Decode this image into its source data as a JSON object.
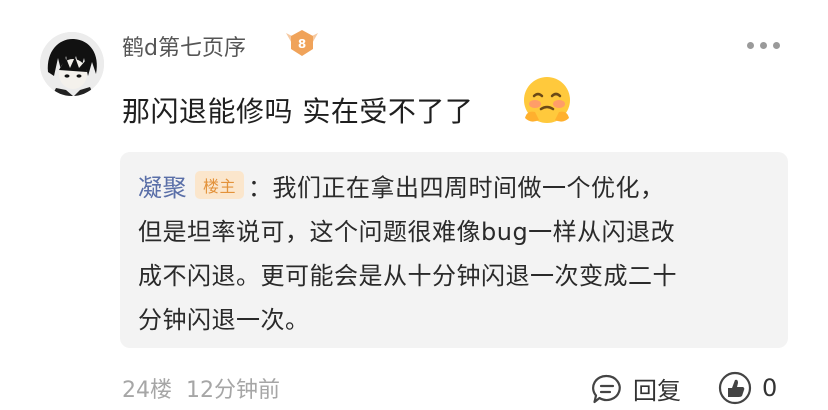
{
  "comment": {
    "username": "鹤d第七页序",
    "level": "8",
    "text": "那闪退能修吗 实在受不了了",
    "emoji_name": "hot-face-emoji"
  },
  "reply": {
    "author": "凝聚",
    "host_badge": "楼主",
    "separator": "：",
    "lines": [
      "我们正在拿出四周时间做一个优化，",
      "但是坦率说可，这个问题很难像bug一样从闪退改",
      "成不闪退。更可能会是从十分钟闪退一次变成二十",
      "分钟闪退一次。"
    ]
  },
  "footer": {
    "floor": "24楼",
    "time": "12分钟前",
    "reply_label": "回复",
    "like_count": "0"
  },
  "colors": {
    "author_link": "#5a6fa8",
    "badge_bg": "#fbe6cc",
    "badge_text": "#e3923a",
    "level_badge": "#f0a35a",
    "muted": "#a6a6a6"
  },
  "icons": [
    "more-icon",
    "reply-icon",
    "like-icon",
    "level-badge-icon"
  ]
}
